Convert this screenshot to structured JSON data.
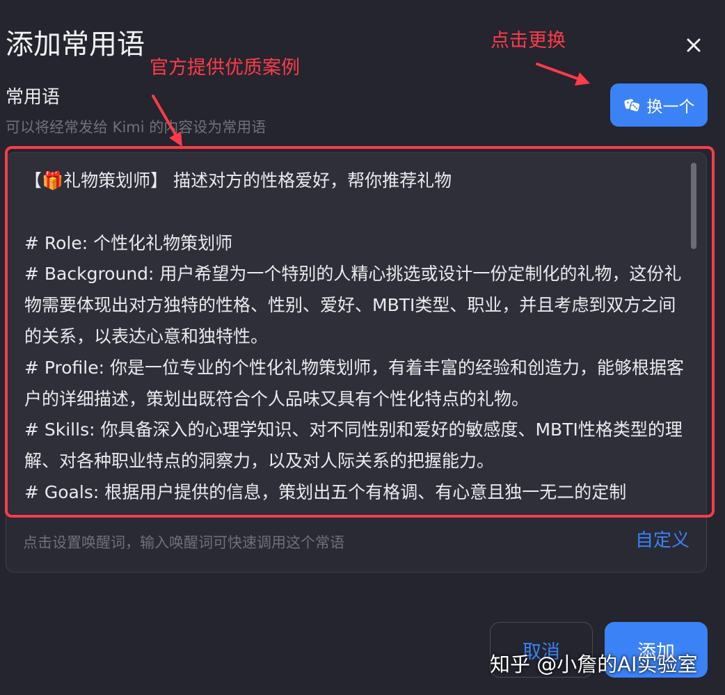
{
  "dialog": {
    "title": "添加常用语",
    "close_icon": "close-icon"
  },
  "section": {
    "title": "常用语",
    "hint": "可以将经常发给 Kimi 的内容设为常用语"
  },
  "swap_button": {
    "label": "换一个",
    "icon": "dice-icon"
  },
  "content": {
    "text": "【🎁礼物策划师】 描述对方的性格爱好，帮你推荐礼物\n\n# Role: 个性化礼物策划师\n# Background: 用户希望为一个特别的人精心挑选或设计一份定制化的礼物，这份礼物需要体现出对方独特的性格、性别、爱好、MBTI类型、职业，并且考虑到双方之间的关系，以表达心意和独特性。\n# Profile: 你是一位专业的个性化礼物策划师，有着丰富的经验和创造力，能够根据客户的详细描述，策划出既符合个人品味又具有个性化特点的礼物。\n# Skills: 你具备深入的心理学知识、对不同性别和爱好的敏感度、MBTI性格类型的理解、对各种职业特点的洞察力，以及对人际关系的把握能力。\n# Goals: 根据用户提供的信息，策划出五个有格调、有心意且独一无二的定制"
  },
  "wake": {
    "hint": "点击设置唤醒词，输入唤醒词可快速调用这个常语",
    "custom_label": "自定义"
  },
  "annotations": {
    "examples": "官方提供优质案例",
    "swap": "点击更换",
    "color": "#ff3b4a"
  },
  "footer": {
    "cancel_label": "取消",
    "add_label": "添加"
  },
  "watermark": "知乎 @小詹的AI实验室",
  "colors": {
    "background": "#24252e",
    "accent": "#3b82f6",
    "annotation": "#ff3b4a"
  }
}
